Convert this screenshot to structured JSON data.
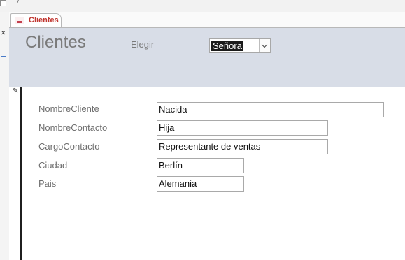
{
  "tab": {
    "label": "Clientes"
  },
  "header": {
    "title": "Clientes",
    "choose_label": "Elegir",
    "choose_value": "Señora"
  },
  "fields": [
    {
      "label": "NombreCliente",
      "value": "Nacida"
    },
    {
      "label": "NombreContacto",
      "value": "Hija"
    },
    {
      "label": "CargoContacto",
      "value": "Representante de ventas"
    },
    {
      "label": "Ciudad",
      "value": "Berlín"
    },
    {
      "label": "Pais",
      "value": "Alemania"
    }
  ],
  "icons": {
    "tab": "form-icon",
    "record_selector": "pencil-icon",
    "combo": "chevron-down-icon"
  },
  "colors": {
    "header_bg": "#d8dde7",
    "tab_accent": "#c0352f",
    "label_text": "#6f6f6f"
  }
}
